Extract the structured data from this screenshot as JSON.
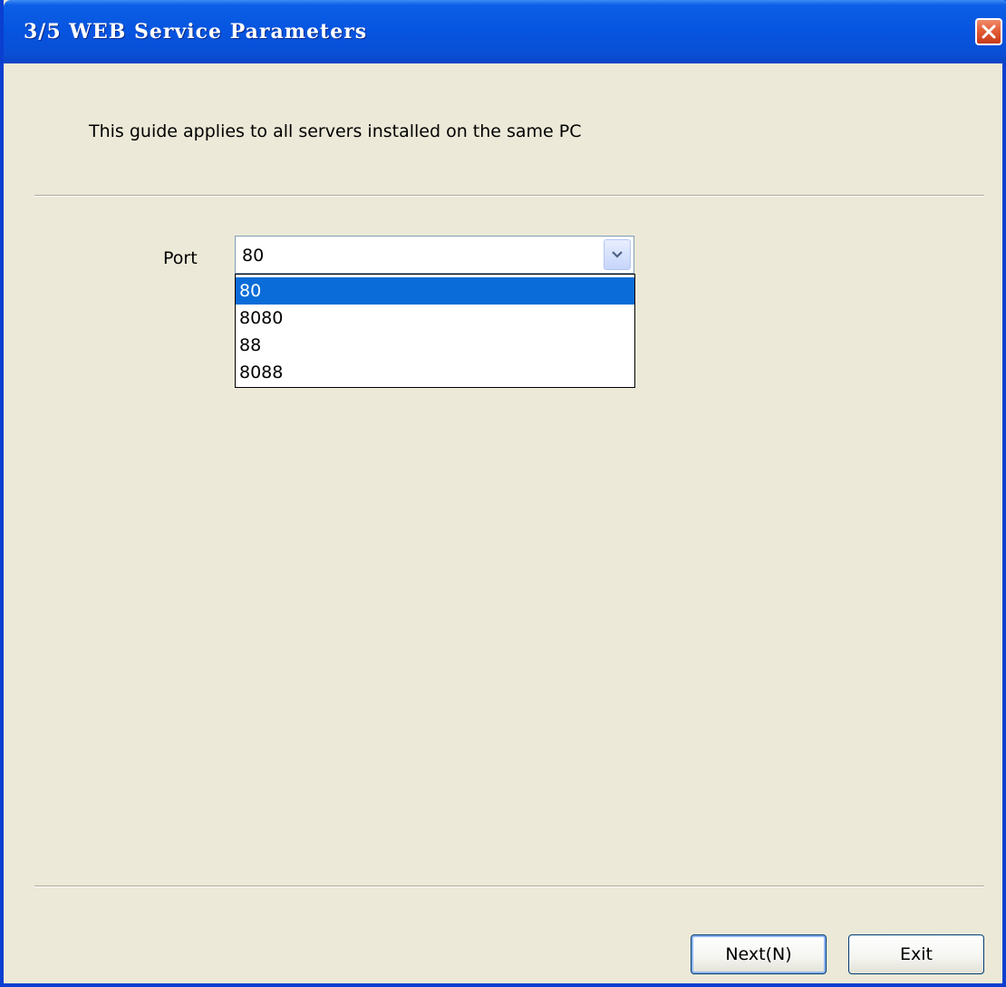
{
  "window": {
    "title": "3/5  WEB Service Parameters"
  },
  "guide": {
    "text": "This guide applies to all servers installed on the same PC"
  },
  "port": {
    "label": "Port",
    "value": "80",
    "options": [
      "80",
      "8080",
      "88",
      "8088"
    ],
    "selected_index": 0
  },
  "buttons": {
    "next": "Next(N)",
    "exit": "Exit"
  },
  "colors": {
    "titlebar": "#0654e0",
    "dialog_bg": "#ece9d8",
    "selection": "#0a6cd8",
    "close": "#e05a32"
  }
}
